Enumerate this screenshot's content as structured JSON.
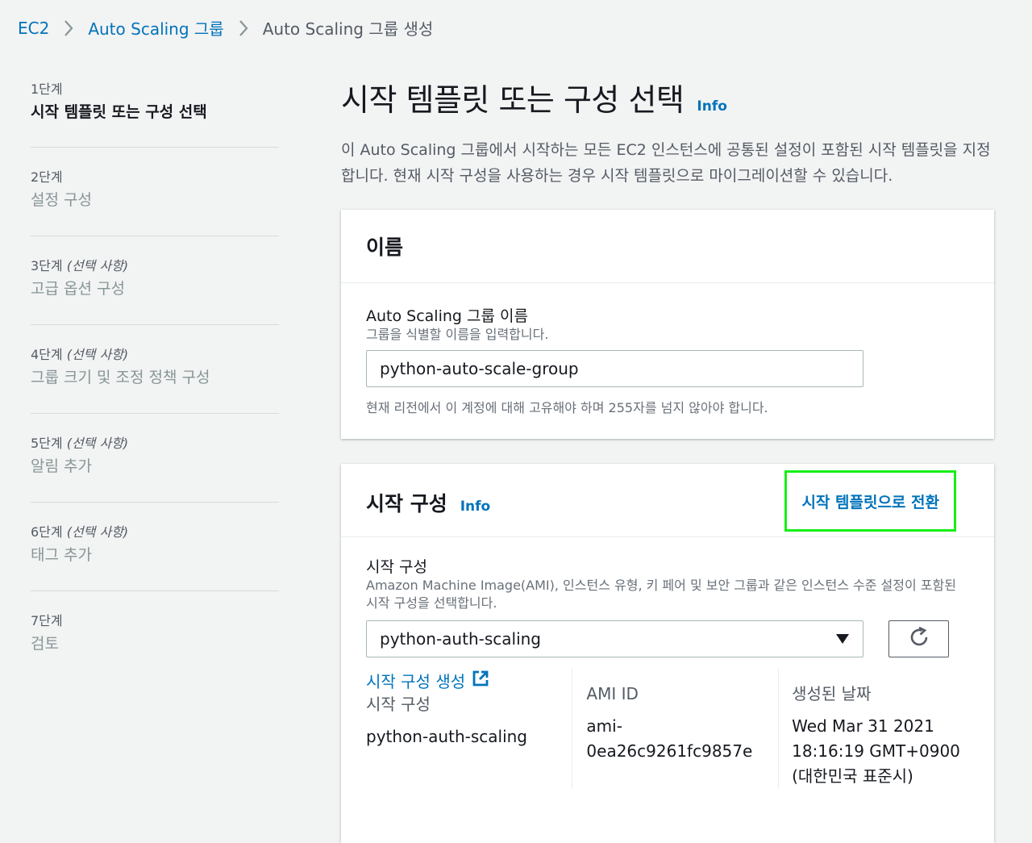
{
  "breadcrumb": {
    "items": [
      "EC2",
      "Auto Scaling 그룹"
    ],
    "current": "Auto Scaling 그룹 생성"
  },
  "steps": [
    {
      "num": "1단계",
      "optional": "",
      "title": "시작 템플릿 또는 구성 선택"
    },
    {
      "num": "2단계",
      "optional": "",
      "title": "설정 구성"
    },
    {
      "num": "3단계",
      "optional": "(선택 사항)",
      "title": "고급 옵션 구성"
    },
    {
      "num": "4단계",
      "optional": "(선택 사항)",
      "title": "그룹 크기 및 조정 정책 구성"
    },
    {
      "num": "5단계",
      "optional": "(선택 사항)",
      "title": "알림 추가"
    },
    {
      "num": "6단계",
      "optional": "(선택 사항)",
      "title": "태그 추가"
    },
    {
      "num": "7단계",
      "optional": "",
      "title": "검토"
    }
  ],
  "page": {
    "title": "시작 템플릿 또는 구성 선택",
    "info": "Info",
    "description": "이 Auto Scaling 그룹에서 시작하는 모든 EC2 인스턴스에 공통된 설정이 포함된 시작 템플릿을 지정합니다. 현재 시작 구성을 사용하는 경우 시작 템플릿으로 마이그레이션할 수 있습니다."
  },
  "name_panel": {
    "title": "이름",
    "field_label": "Auto Scaling 그룹 이름",
    "field_desc": "그룹을 식별할 이름을 입력합니다.",
    "value": "python-auto-scale-group",
    "constraint": "현재 리전에서 이 계정에 대해 고유해야 하며 255자를 넘지 않아야 합니다."
  },
  "launch_panel": {
    "title": "시작 구성",
    "info": "Info",
    "switch_label": "시작 템플릿으로 전환",
    "field_label": "시작 구성",
    "field_desc": "Amazon Machine Image(AMI), 인스턴스 유형, 키 페어 및 보안 그룹과 같은 인스턴스 수준 설정이 포함된 시작 구성을 선택합니다.",
    "selected": "python-auth-scaling",
    "create_link": "시작 구성 생성",
    "details": {
      "col1_key": "시작 구성",
      "col1_val": "python-auth-scaling",
      "col2_key": "AMI ID",
      "col2_val_line1": "ami-",
      "col2_val_line2": "0ea26c9261fc9857e",
      "col3_key": "생성된 날짜",
      "col3_val_line1": "Wed Mar 31 2021",
      "col3_val_line2": "18:16:19 GMT+0900",
      "col3_val_line3": "(대한민국 표준시)"
    }
  }
}
